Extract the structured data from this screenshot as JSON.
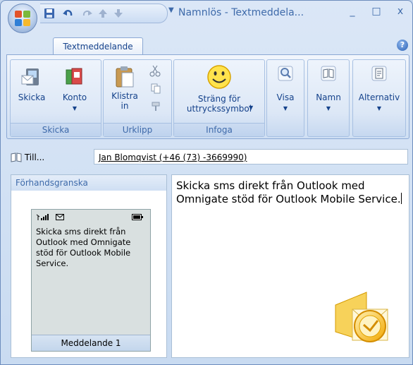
{
  "window": {
    "title": "Namnlös - Textmeddela...",
    "controls": {
      "minimize": "_",
      "maximize": "□",
      "close": "x"
    }
  },
  "ribbon": {
    "active_tab": "Textmeddelande",
    "help": "?",
    "groups": [
      {
        "label": "Skicka",
        "buttons": [
          "Skicka",
          "Konto"
        ]
      },
      {
        "label": "Urklipp",
        "buttons": [
          "Klistra\nin"
        ]
      },
      {
        "label": "Infoga",
        "buttons": [
          "Sträng för\nuttryckssymbol"
        ]
      },
      {
        "label": "",
        "buttons": [
          "Visa"
        ]
      },
      {
        "label": "",
        "buttons": [
          "Namn"
        ]
      },
      {
        "label": "",
        "buttons": [
          "Alternativ"
        ]
      }
    ]
  },
  "recipient": {
    "button_label": "Till...",
    "value": "Jan Blomqvist (+46 (73) -3669990)"
  },
  "preview": {
    "header": "Förhandsgranska",
    "message": "Skicka sms direkt från Outlook med Omnigate stöd för Outlook Mobile Service.",
    "footer": "Meddelande 1"
  },
  "editor": {
    "text": "Skicka sms direkt från Outlook med Omnigate stöd för Outlook Mobile Service."
  },
  "icons": {
    "office_button": "office-logo-icon",
    "outlook": "outlook-logo-icon"
  }
}
